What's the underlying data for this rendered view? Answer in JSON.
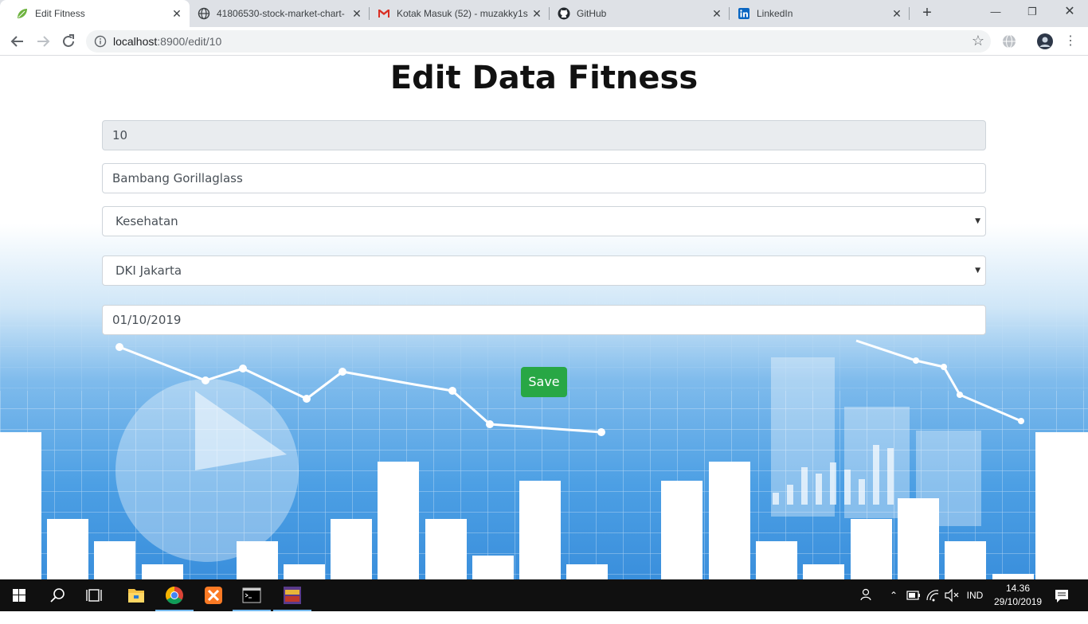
{
  "browser": {
    "tabs": [
      {
        "title": "Edit Fitness",
        "active": true,
        "icon": "spring-leaf-icon"
      },
      {
        "title": "41806530-stock-market-chart-",
        "active": false,
        "icon": "globe-icon"
      },
      {
        "title": "Kotak Masuk (52) - muzakky1s",
        "active": false,
        "icon": "gmail-icon"
      },
      {
        "title": "GitHub",
        "active": false,
        "icon": "github-icon"
      },
      {
        "title": "LinkedIn",
        "active": false,
        "icon": "linkedin-icon"
      }
    ],
    "url_host": "localhost",
    "url_rest": ":8900/edit/10"
  },
  "page": {
    "title": "Edit Data Fitness",
    "id_value": "10",
    "name_value": "Bambang Gorillaglass",
    "category_value": "Kesehatan",
    "city_value": "DKI Jakarta",
    "date_value": "01/10/2019",
    "save_label": "Save"
  },
  "taskbar": {
    "language": "IND",
    "time": "14.36",
    "date": "29/10/2019"
  },
  "colors": {
    "save_button": "#28a745",
    "readonly_field": "#e9ecef",
    "chart_sky": "#5aa6e6"
  }
}
